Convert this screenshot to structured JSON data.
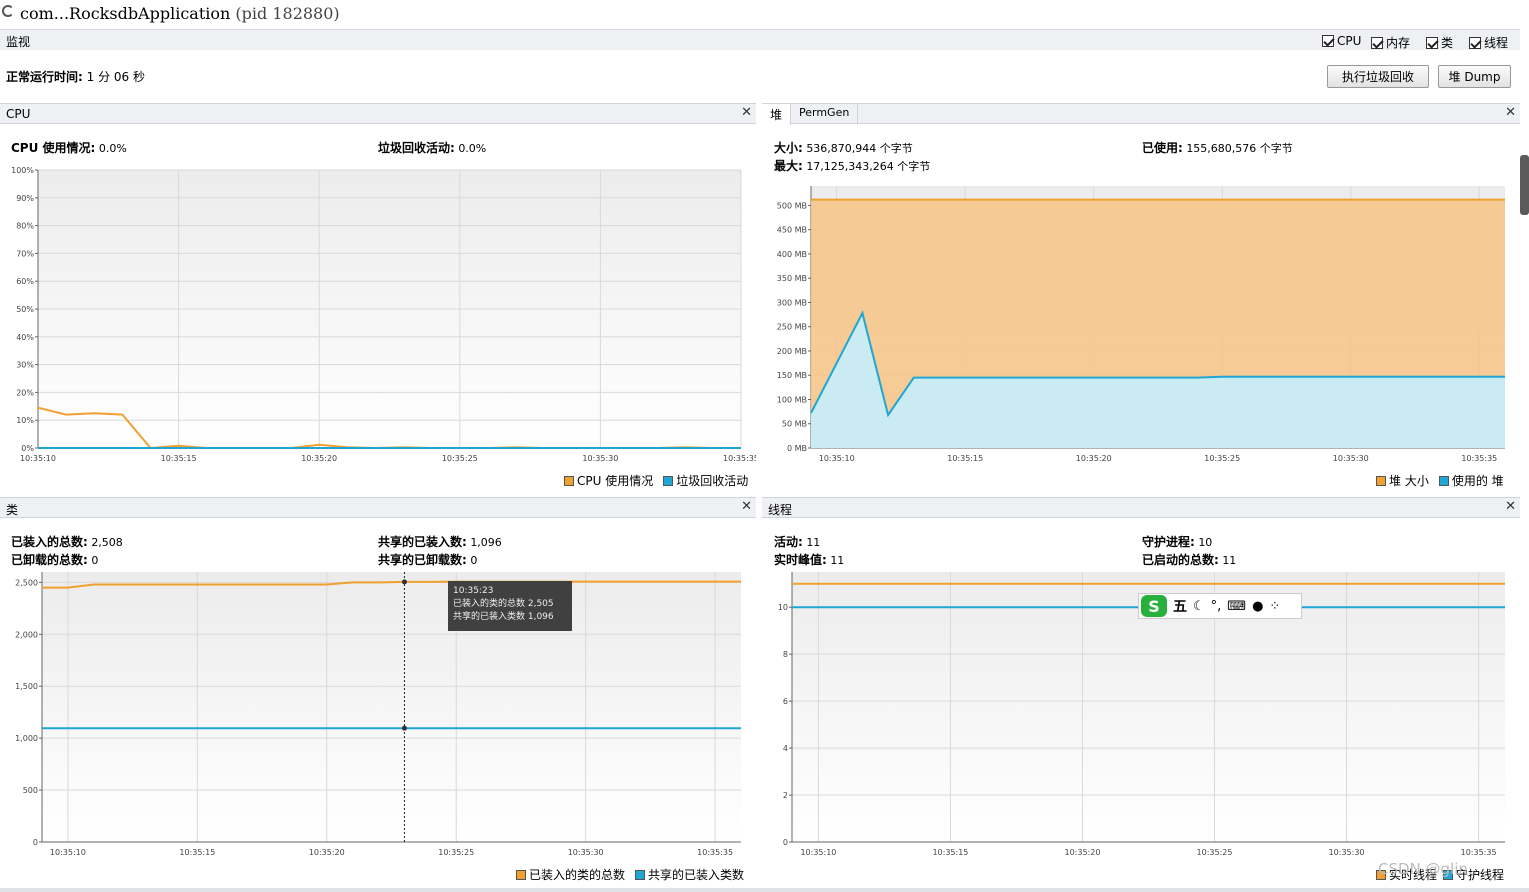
{
  "title": {
    "app": "com...RocksdbApplication",
    "pid": "(pid 182880)"
  },
  "monitor": {
    "label": "监视",
    "checkboxes": [
      {
        "label": "CPU"
      },
      {
        "label": "内存"
      },
      {
        "label": "类"
      },
      {
        "label": "线程"
      }
    ],
    "uptime_label": "正常运行时间:",
    "uptime_value": "1 分 06 秒",
    "gc_button": "执行垃圾回收",
    "dump_button": "堆 Dump"
  },
  "cpu_panel": {
    "title": "CPU",
    "usage_label": "CPU 使用情况:",
    "usage_value": "0.0%",
    "gc_label": "垃圾回收活动:",
    "gc_value": "0.0%",
    "legend": [
      "CPU 使用情况",
      "垃圾回收活动"
    ]
  },
  "heap_panel": {
    "tabs": [
      "堆",
      "PermGen"
    ],
    "size_label": "大小:",
    "size_value": "536,870,944 个字节",
    "max_label": "最大:",
    "max_value": "17,125,343,264 个字节",
    "used_label": "已使用:",
    "used_value": "155,680,576 个字节",
    "legend": [
      "堆 大小",
      "使用的 堆"
    ]
  },
  "classes_panel": {
    "title": "类",
    "loaded_label": "已装入的总数:",
    "loaded_value": "2,508",
    "unloaded_label": "已卸载的总数:",
    "unloaded_value": "0",
    "shared_loaded_label": "共享的已装入数:",
    "shared_loaded_value": "1,096",
    "shared_unloaded_label": "共享的已卸载数:",
    "shared_unloaded_value": "0",
    "legend": [
      "已装入的类的总数",
      "共享的已装入类数"
    ],
    "tooltip": {
      "time": "10:35:23",
      "line1": "已装入的类的总数  2,505",
      "line2": "共享的已装入类数  1,096"
    }
  },
  "threads_panel": {
    "title": "线程",
    "live_label": "活动:",
    "live_value": "11",
    "peak_label": "实时峰值:",
    "peak_value": "11",
    "daemon_label": "守护进程:",
    "daemon_value": "10",
    "started_label": "已启动的总数:",
    "started_value": "11",
    "legend": [
      "实时线程",
      "守护线程"
    ]
  },
  "ime": {
    "mode": "五"
  },
  "watermark": "CSDN @glin...",
  "colors": {
    "orange": "#f0a030",
    "blue": "#1fa6d4",
    "orange_fill": "#f6c58a",
    "blue_fill": "#c8ecf8"
  },
  "chart_data": [
    {
      "type": "line",
      "title": "CPU",
      "x": [
        "10:35:10",
        "10:35:11",
        "10:35:12",
        "10:35:13",
        "10:35:14",
        "10:35:15",
        "10:35:16",
        "10:35:17",
        "10:35:18",
        "10:35:19",
        "10:35:20",
        "10:35:21",
        "10:35:22",
        "10:35:23",
        "10:35:24",
        "10:35:25",
        "10:35:26",
        "10:35:27",
        "10:35:28",
        "10:35:29",
        "10:35:30",
        "10:35:31",
        "10:35:32",
        "10:35:33",
        "10:35:34",
        "10:35:35"
      ],
      "xticks": [
        "10:35:10",
        "10:35:15",
        "10:35:20",
        "10:35:25",
        "10:35:30",
        "10:35:35"
      ],
      "yticks": [
        "0%",
        "10%",
        "20%",
        "30%",
        "40%",
        "50%",
        "60%",
        "70%",
        "80%",
        "90%",
        "100%"
      ],
      "ylim": [
        0,
        100
      ],
      "series": [
        {
          "name": "CPU 使用情况",
          "values": [
            14.5,
            12,
            12.5,
            12,
            0,
            0.8,
            0,
            0,
            0,
            0,
            1.2,
            0.3,
            0,
            0.3,
            0,
            0,
            0,
            0.3,
            0,
            0,
            0,
            0,
            0,
            0.3,
            0,
            0
          ]
        },
        {
          "name": "垃圾回收活动",
          "values": [
            0,
            0,
            0,
            0,
            0,
            0,
            0,
            0,
            0,
            0,
            0,
            0,
            0,
            0,
            0,
            0,
            0,
            0,
            0,
            0,
            0,
            0,
            0,
            0,
            0,
            0
          ]
        }
      ]
    },
    {
      "type": "area",
      "title": "堆",
      "x": [
        "10:35:09",
        "10:35:10",
        "10:35:11",
        "10:35:12",
        "10:35:13",
        "10:35:14",
        "10:35:15",
        "10:35:16",
        "10:35:17",
        "10:35:18",
        "10:35:19",
        "10:35:20",
        "10:35:21",
        "10:35:22",
        "10:35:23",
        "10:35:24",
        "10:35:25",
        "10:35:26",
        "10:35:27",
        "10:35:28",
        "10:35:29",
        "10:35:30",
        "10:35:31",
        "10:35:32",
        "10:35:33",
        "10:35:34",
        "10:35:35",
        "10:35:36"
      ],
      "xticks": [
        "10:35:10",
        "10:35:15",
        "10:35:20",
        "10:35:25",
        "10:35:30",
        "10:35:35"
      ],
      "yticks": [
        "0 MB",
        "50 MB",
        "100 MB",
        "150 MB",
        "200 MB",
        "250 MB",
        "300 MB",
        "350 MB",
        "400 MB",
        "450 MB",
        "500 MB"
      ],
      "ylim": [
        0,
        540
      ],
      "series": [
        {
          "name": "堆 大小",
          "values": [
            512,
            512,
            512,
            512,
            512,
            512,
            512,
            512,
            512,
            512,
            512,
            512,
            512,
            512,
            512,
            512,
            512,
            512,
            512,
            512,
            512,
            512,
            512,
            512,
            512,
            512,
            512,
            512
          ]
        },
        {
          "name": "使用的 堆",
          "values": [
            72,
            175,
            278,
            68,
            145,
            145,
            145,
            145,
            145,
            145,
            145,
            145,
            145,
            145,
            145,
            145,
            147,
            147,
            147,
            147,
            147,
            147,
            147,
            147,
            147,
            147,
            147,
            147
          ]
        }
      ]
    },
    {
      "type": "line",
      "title": "类",
      "x": [
        "10:35:09",
        "10:35:10",
        "10:35:11",
        "10:35:12",
        "10:35:13",
        "10:35:14",
        "10:35:15",
        "10:35:16",
        "10:35:17",
        "10:35:18",
        "10:35:19",
        "10:35:20",
        "10:35:21",
        "10:35:22",
        "10:35:23",
        "10:35:24",
        "10:35:25",
        "10:35:26",
        "10:35:27",
        "10:35:28",
        "10:35:29",
        "10:35:30",
        "10:35:31",
        "10:35:32",
        "10:35:33",
        "10:35:34",
        "10:35:35",
        "10:35:36"
      ],
      "xticks": [
        "10:35:10",
        "10:35:15",
        "10:35:20",
        "10:35:25",
        "10:35:30",
        "10:35:35"
      ],
      "yticks": [
        "0",
        "500",
        "1,000",
        "1,500",
        "2,000",
        "2,500"
      ],
      "ylim": [
        0,
        2600
      ],
      "series": [
        {
          "name": "已装入的类的总数",
          "values": [
            2450,
            2450,
            2480,
            2480,
            2480,
            2480,
            2480,
            2480,
            2480,
            2480,
            2480,
            2480,
            2500,
            2500,
            2505,
            2505,
            2508,
            2508,
            2508,
            2508,
            2508,
            2508,
            2508,
            2508,
            2508,
            2508,
            2508,
            2508
          ]
        },
        {
          "name": "共享的已装入类数",
          "values": [
            1096,
            1096,
            1096,
            1096,
            1096,
            1096,
            1096,
            1096,
            1096,
            1096,
            1096,
            1096,
            1096,
            1096,
            1096,
            1096,
            1096,
            1096,
            1096,
            1096,
            1096,
            1096,
            1096,
            1096,
            1096,
            1096,
            1096,
            1096
          ]
        }
      ]
    },
    {
      "type": "line",
      "title": "线程",
      "x": [
        "10:35:09",
        "10:35:10",
        "10:35:11",
        "10:35:12",
        "10:35:13",
        "10:35:14",
        "10:35:15",
        "10:35:16",
        "10:35:17",
        "10:35:18",
        "10:35:19",
        "10:35:20",
        "10:35:21",
        "10:35:22",
        "10:35:23",
        "10:35:24",
        "10:35:25",
        "10:35:26",
        "10:35:27",
        "10:35:28",
        "10:35:29",
        "10:35:30",
        "10:35:31",
        "10:35:32",
        "10:35:33",
        "10:35:34",
        "10:35:35",
        "10:35:36"
      ],
      "xticks": [
        "10:35:10",
        "10:35:15",
        "10:35:20",
        "10:35:25",
        "10:35:30",
        "10:35:35"
      ],
      "yticks": [
        "0",
        "2",
        "4",
        "6",
        "8",
        "10"
      ],
      "ylim": [
        0,
        11.5
      ],
      "series": [
        {
          "name": "实时线程",
          "values": [
            11,
            11,
            11,
            11,
            11,
            11,
            11,
            11,
            11,
            11,
            11,
            11,
            11,
            11,
            11,
            11,
            11,
            11,
            11,
            11,
            11,
            11,
            11,
            11,
            11,
            11,
            11,
            11
          ]
        },
        {
          "name": "守护线程",
          "values": [
            10,
            10,
            10,
            10,
            10,
            10,
            10,
            10,
            10,
            10,
            10,
            10,
            10,
            10,
            10,
            10,
            10,
            10,
            10,
            10,
            10,
            10,
            10,
            10,
            10,
            10,
            10,
            10
          ]
        }
      ]
    }
  ]
}
